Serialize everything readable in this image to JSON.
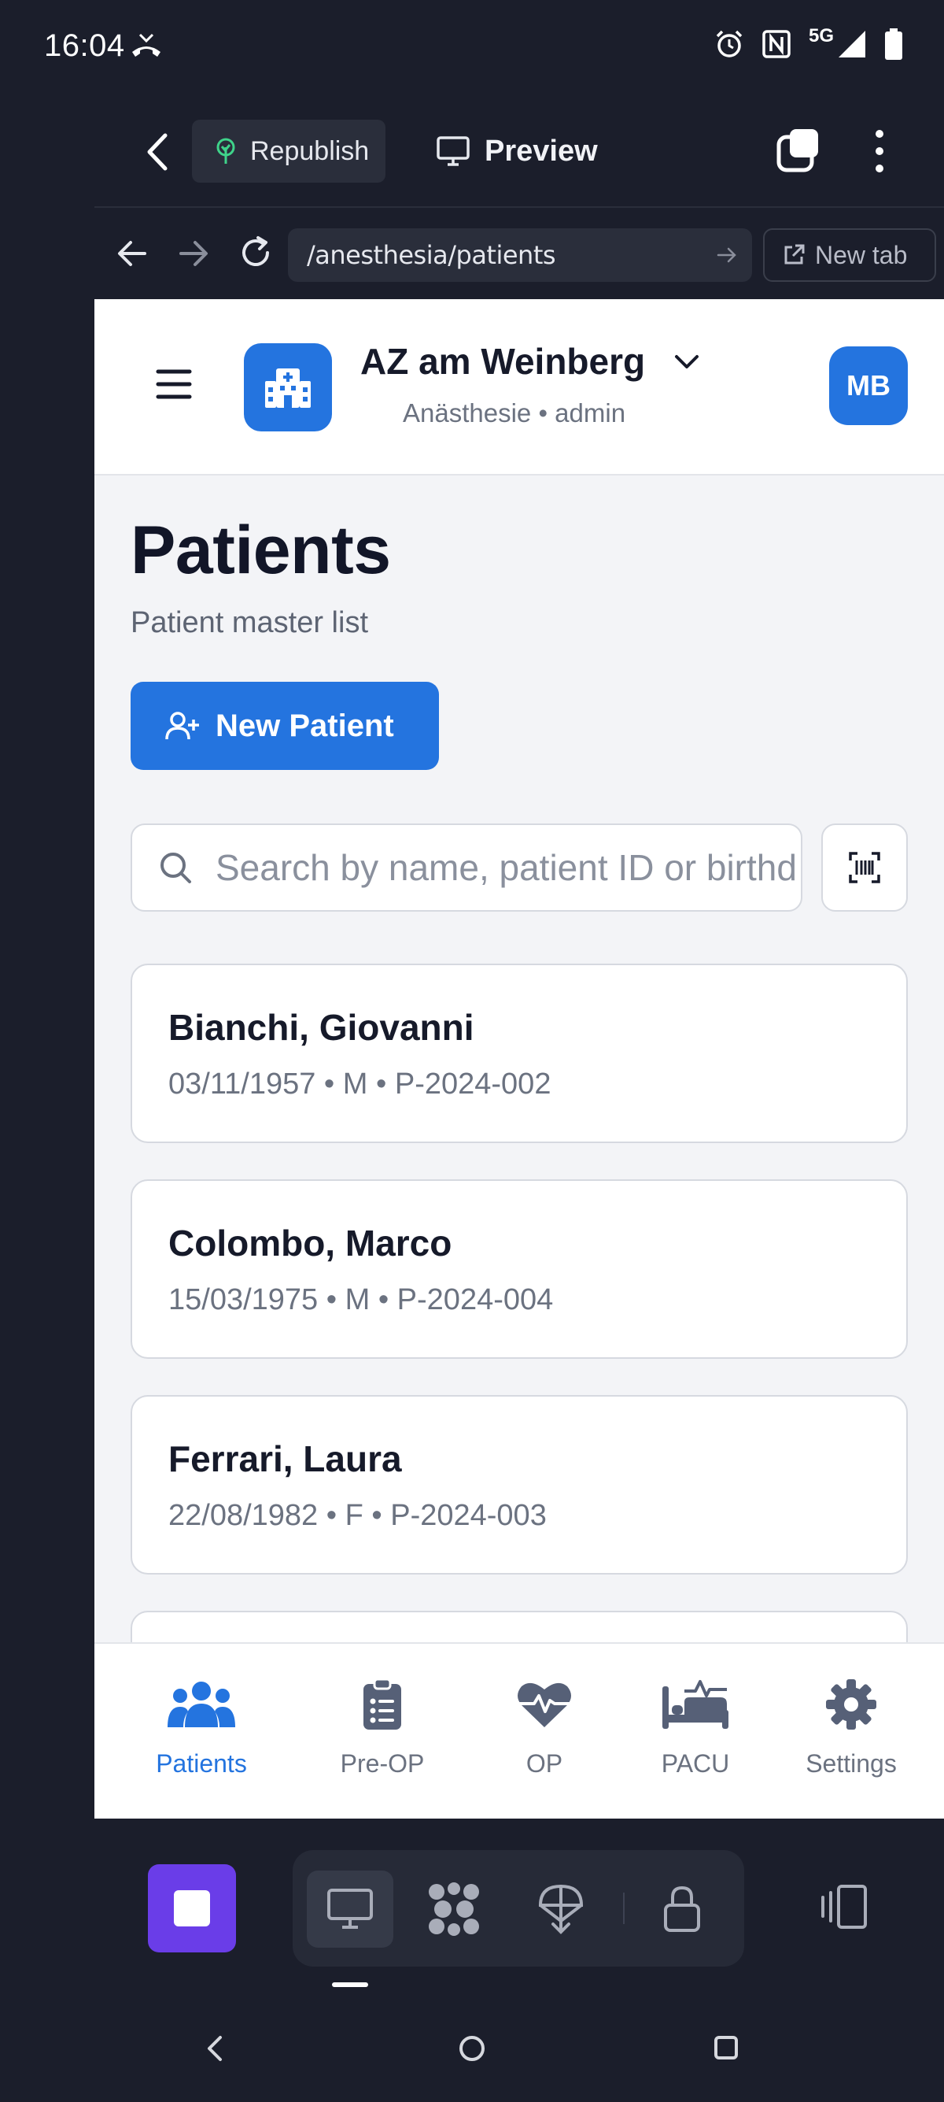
{
  "status_bar": {
    "time": "16:04",
    "network": "5G",
    "icons": [
      "missed-call-icon",
      "alarm-icon",
      "nfc-icon",
      "signal-icon",
      "battery-icon"
    ]
  },
  "editor": {
    "republish_label": "Republish",
    "preview_label": "Preview",
    "url": "/anesthesia/patients",
    "new_tab_label": "New tab"
  },
  "app": {
    "header": {
      "clinic_name": "AZ am Weinberg",
      "clinic_subtitle": "Anästhesie • admin",
      "avatar_initials": "MB"
    },
    "page": {
      "title": "Patients",
      "subtitle": "Patient master list",
      "new_patient_label": "New Patient",
      "search_placeholder": "Search by name, patient ID or birthday"
    },
    "patients": [
      {
        "name": "Bianchi, Giovanni",
        "meta": "03/11/1957 • M • P-2024-002"
      },
      {
        "name": "Colombo, Marco",
        "meta": "15/03/1975 • M • P-2024-004"
      },
      {
        "name": "Ferrari, Laura",
        "meta": "22/08/1982 • F • P-2024-003"
      }
    ],
    "tabs": [
      {
        "label": "Patients",
        "icon": "users-icon",
        "active": true
      },
      {
        "label": "Pre-OP",
        "icon": "clipboard-list-icon",
        "active": false
      },
      {
        "label": "OP",
        "icon": "heart-pulse-icon",
        "active": false
      },
      {
        "label": "PACU",
        "icon": "bed-pulse-icon",
        "active": false
      },
      {
        "label": "Settings",
        "icon": "gear-icon",
        "active": false
      }
    ]
  },
  "colors": {
    "accent": "#2474df",
    "editor_bg": "#1b1e2b",
    "app_bg": "#f3f4f7",
    "purple": "#6a3de8"
  }
}
